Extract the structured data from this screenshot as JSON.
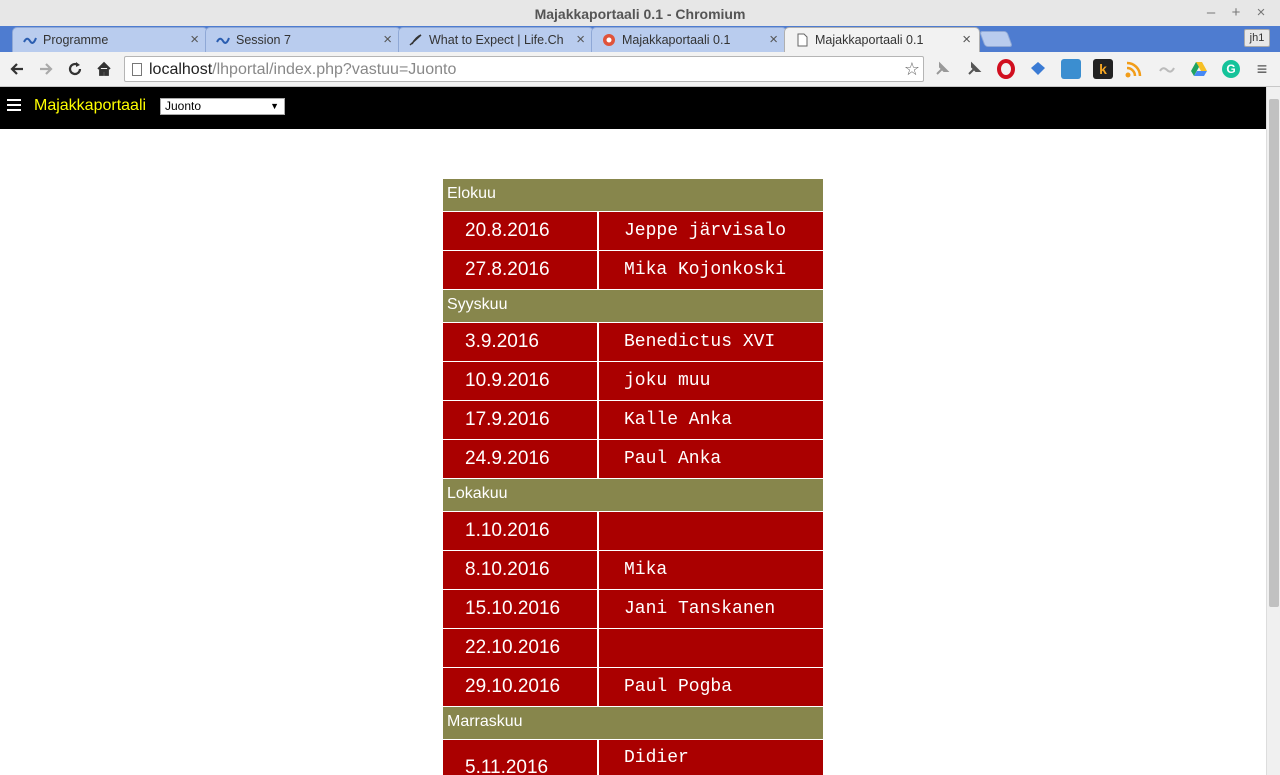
{
  "window": {
    "title": "Majakkaportaali 0.1 - Chromium"
  },
  "tabs": [
    {
      "label": "Programme",
      "icon": "wave-icon"
    },
    {
      "label": "Session 7",
      "icon": "wave-icon"
    },
    {
      "label": "What to Expect | Life.Ch",
      "icon": "quill-icon"
    },
    {
      "label": "Majakkaportaali 0.1",
      "icon": "bug-icon"
    },
    {
      "label": "Majakkaportaali 0.1",
      "icon": "page-icon",
      "active": true
    }
  ],
  "profile": "jh1",
  "omnibox": {
    "host": "localhost",
    "path": "/lhportal/index.php?vastuu=Juonto"
  },
  "app": {
    "brand": "Majakkaportaali",
    "role": "Juonto"
  },
  "schedule": [
    {
      "month": "Elokuu",
      "rows": [
        {
          "date": "20.8.2016",
          "name": "Jeppe järvisalo"
        },
        {
          "date": "27.8.2016",
          "name": "Mika Kojonkoski"
        }
      ]
    },
    {
      "month": "Syyskuu",
      "rows": [
        {
          "date": "3.9.2016",
          "name": "Benedictus XVI"
        },
        {
          "date": "10.9.2016",
          "name": "joku muu"
        },
        {
          "date": "17.9.2016",
          "name": "Kalle Anka"
        },
        {
          "date": "24.9.2016",
          "name": "Paul Anka"
        }
      ]
    },
    {
      "month": "Lokakuu",
      "rows": [
        {
          "date": "1.10.2016",
          "name": ""
        },
        {
          "date": "8.10.2016",
          "name": "Mika"
        },
        {
          "date": "15.10.2016",
          "name": "Jani Tanskanen"
        },
        {
          "date": "22.10.2016",
          "name": ""
        },
        {
          "date": "29.10.2016",
          "name": "Paul Pogba"
        }
      ]
    },
    {
      "month": "Marraskuu",
      "rows": [
        {
          "date": "5.11.2016",
          "name": "Didier"
        }
      ]
    }
  ],
  "colors": {
    "month_bg": "#87864c",
    "cell_bg": "#aa0000",
    "brand": "#ffff00"
  }
}
